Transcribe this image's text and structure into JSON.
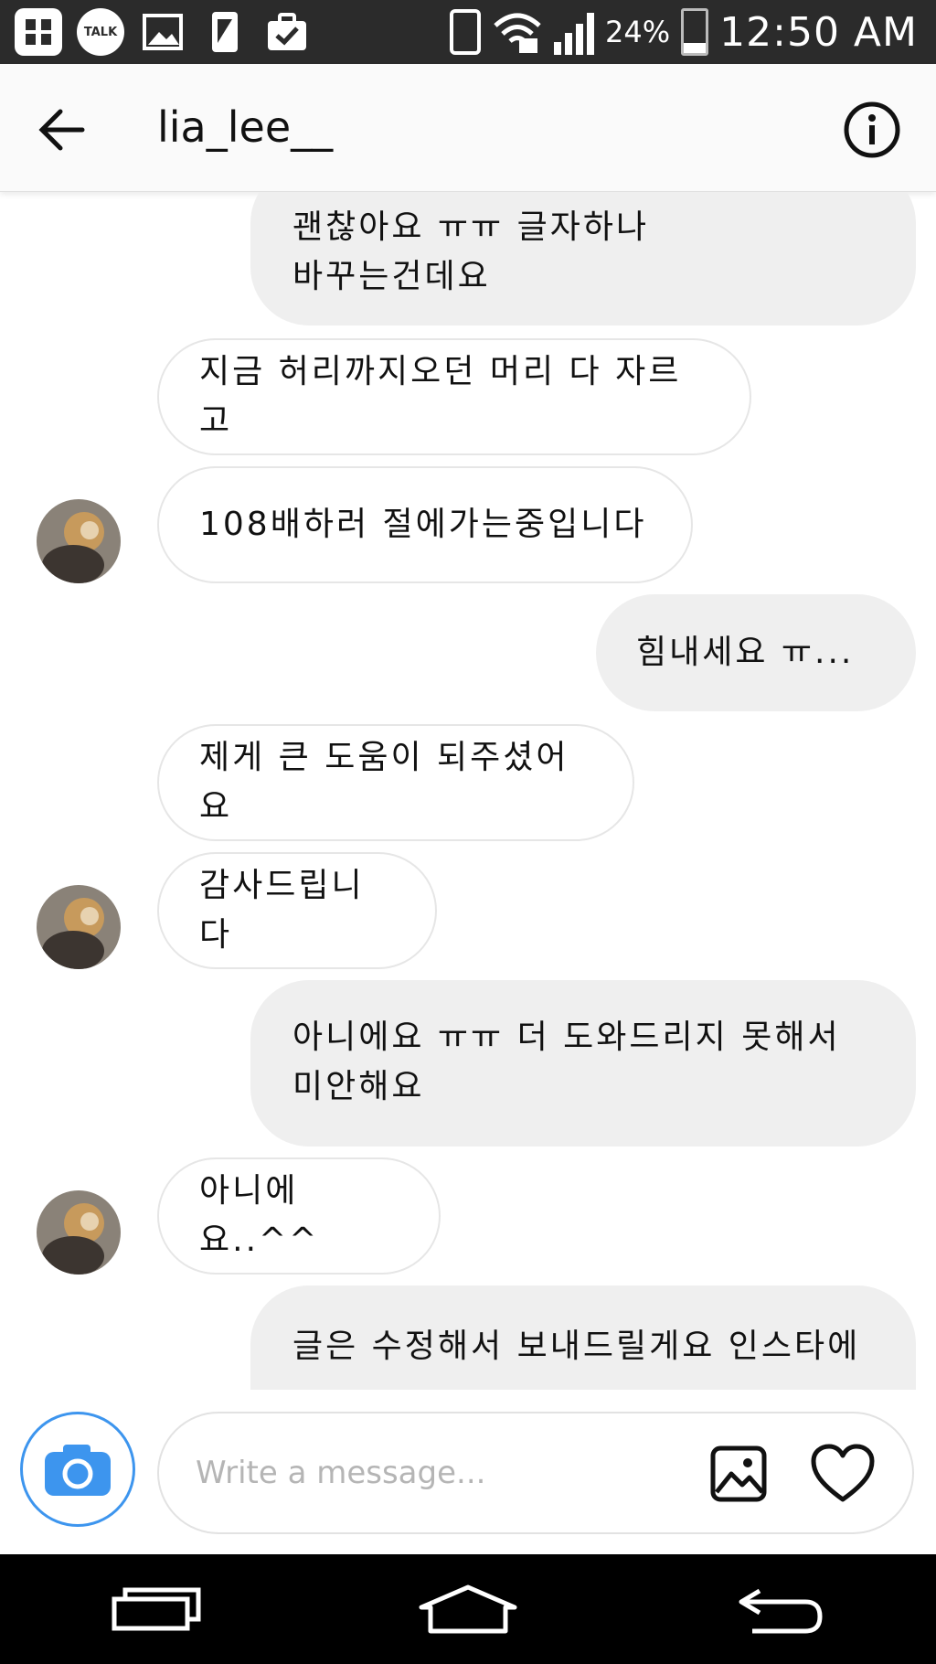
{
  "status_bar": {
    "talk_label": "TALK",
    "battery_percent": "24%",
    "time": "12:50 AM"
  },
  "header": {
    "username": "lia_lee__"
  },
  "messages": [
    {
      "direction": "outgoing",
      "lines": [
        "괜찮아요 ㅠㅠ 글자하나",
        "바꾸는건데요"
      ]
    },
    {
      "direction": "incoming",
      "lines": [
        "지금 허리까지오던 머리 다 자르고"
      ]
    },
    {
      "direction": "incoming",
      "lines": [
        "108배하러 절에가는중입니다"
      ]
    },
    {
      "direction": "outgoing",
      "lines": [
        "힘내세요 ㅠ..."
      ]
    },
    {
      "direction": "incoming",
      "lines": [
        "제게 큰 도움이 되주셨어요"
      ]
    },
    {
      "direction": "incoming",
      "lines": [
        "감사드립니다"
      ]
    },
    {
      "direction": "outgoing",
      "lines": [
        "아니에요 ㅠㅠ 더 도와드리지 못해서",
        "미안해요"
      ]
    },
    {
      "direction": "incoming",
      "lines": [
        "아니에요..^^"
      ]
    },
    {
      "direction": "outgoing",
      "lines": [
        "글은 수정해서 보내드릴게요 인스타에"
      ]
    }
  ],
  "composer": {
    "placeholder": "Write a message..."
  },
  "icons": {
    "camera": "camera-icon",
    "gallery": "gallery-icon",
    "heart": "heart-icon",
    "back": "back-arrow-icon",
    "info": "info-icon"
  },
  "colors": {
    "accent_blue": "#3d95ee",
    "outgoing_bubble": "#efefef",
    "incoming_border": "#e6e6e6"
  }
}
